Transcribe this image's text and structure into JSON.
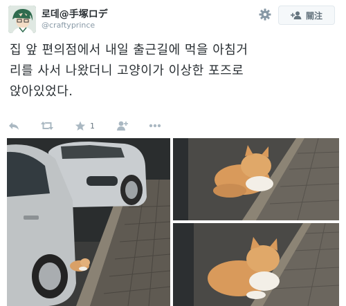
{
  "user": {
    "display_name": "로데@手塚ロデ",
    "handle": "@craftyprince"
  },
  "follow_button": {
    "label": "關注",
    "icon": "add-user-icon"
  },
  "settings_icon": "gear-icon",
  "tweet": {
    "text": "집 앞 편의점에서 내일 출근길에 먹을 아침거\n리를 사서 나왔더니 고양이가 이상한 포즈로\n앉아있었다."
  },
  "actions": {
    "reply_icon": "reply-icon",
    "retweet_icon": "retweet-icon",
    "like_icon": "star-icon",
    "like_count": "1",
    "follow_icon": "person-add-icon",
    "more_icon": "more-icon"
  },
  "photos": [
    {
      "description_icon": "photo-car-cat"
    },
    {
      "description_icon": "photo-cat-curb"
    },
    {
      "description_icon": "photo-cat-closeup"
    }
  ],
  "colors": {
    "text": "#292f33",
    "muted": "#8899a6",
    "action": "#aab8c2",
    "button_bg": "#f5f8fa",
    "button_border": "#e1e8ed"
  }
}
